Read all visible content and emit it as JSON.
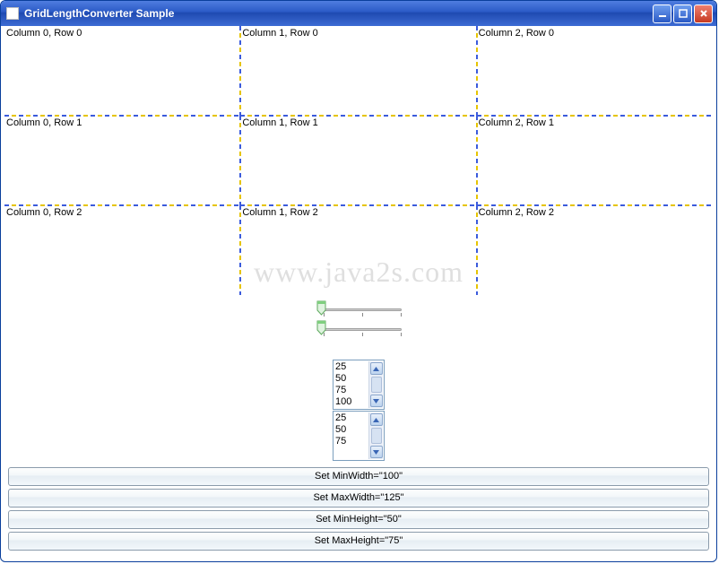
{
  "window": {
    "title": "GridLengthConverter Sample"
  },
  "grid": {
    "cells": [
      [
        "Column 0, Row 0",
        "Column 1, Row 0",
        "Column 2, Row 0"
      ],
      [
        "Column 0, Row 1",
        "Column 1, Row 1",
        "Column 2, Row 1"
      ],
      [
        "Column 0, Row 2",
        "Column 1, Row 2",
        "Column 2, Row 2"
      ]
    ]
  },
  "watermark": "www.java2s.com",
  "listbox1": {
    "items": [
      "25",
      "50",
      "75",
      "100"
    ]
  },
  "listbox2": {
    "items": [
      "25",
      "50",
      "75"
    ]
  },
  "buttons": {
    "minwidth": "Set MinWidth=\"100\"",
    "maxwidth": "Set MaxWidth=\"125\"",
    "minheight": "Set MinHeight=\"50\"",
    "maxheight": "Set MaxHeight=\"75\""
  }
}
